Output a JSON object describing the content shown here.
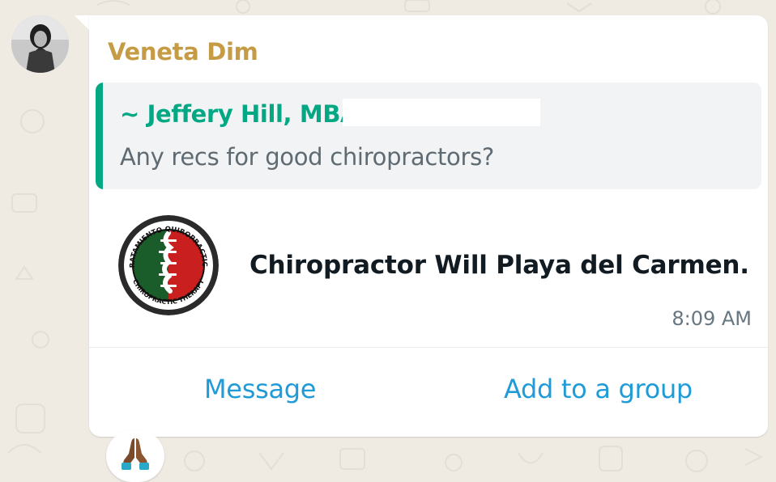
{
  "message": {
    "sender_name": "Veneta Dim",
    "quote": {
      "author": "~ Jeffery Hill, MBA",
      "text": "Any recs for good chiropractors?"
    },
    "contact": {
      "name": "Chiropractor Will Playa del Carmen.",
      "logo_text_top": "TRATAMIENTO QUIROPRACTICO",
      "logo_text_bottom": "CHIROPRACTIC THERAPY"
    },
    "time": "8:09 AM",
    "actions": {
      "message_label": "Message",
      "add_group_label": "Add to a group"
    },
    "reaction": {
      "emoji": "folded-hands"
    }
  },
  "colors": {
    "background": "#efeae2",
    "sender": "#c69b45",
    "quote_accent": "#06a884",
    "action": "#1f9bd8"
  }
}
